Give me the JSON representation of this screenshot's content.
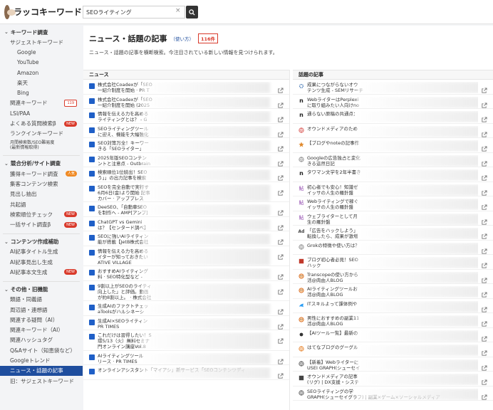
{
  "app": {
    "logo_text": "ラッコキーワード"
  },
  "search": {
    "value": "SEOライティング",
    "clear_glyph": "×"
  },
  "sidebar": {
    "keyword_section": {
      "title": "キーワード調査",
      "items": [
        {
          "label": "サジェストキーワード",
          "level": 1
        },
        {
          "label": "Google",
          "level": 2
        },
        {
          "label": "YouTube",
          "level": 2
        },
        {
          "label": "Amazon",
          "level": 2
        },
        {
          "label": "楽天",
          "level": 2
        },
        {
          "label": "Bing",
          "level": 2
        },
        {
          "label": "関連キーワード",
          "level": 1,
          "badge": "119",
          "badge_type": "count"
        },
        {
          "label": "LSI/PAA",
          "level": 1
        },
        {
          "label": "よくある質問検索β",
          "level": 1,
          "badge": "NEW",
          "badge_type": "new"
        },
        {
          "label": "ランクインキーワード",
          "level": 1
        },
        {
          "label": "月間検索数/SEO難易度\n(最新情報取得)",
          "level": 1,
          "small": true
        }
      ]
    },
    "competitor_section": {
      "title": "競合分析/サイト調査",
      "items": [
        {
          "label": "獲得キーワード調査",
          "badge": "人気",
          "badge_type": "popular"
        },
        {
          "label": "集客コンテンツ検索"
        },
        {
          "label": "見出し抽出"
        },
        {
          "label": "共起語"
        },
        {
          "label": "検索順位チェック",
          "badge": "NEW",
          "badge_type": "new"
        },
        {
          "label": "一括サイト調査β",
          "badge": "NEW",
          "badge_type": "new"
        }
      ]
    },
    "content_section": {
      "title": "コンテンツ作成補助",
      "items": [
        {
          "label": "AI記事タイトル生成"
        },
        {
          "label": "AI記事見出し生成"
        },
        {
          "label": "AI記事本文生成",
          "badge": "NEW",
          "badge_type": "new"
        }
      ]
    },
    "other_section": {
      "title": "その他・旧機能",
      "items": [
        {
          "label": "類語・同義語"
        },
        {
          "label": "周辺語・連想語"
        },
        {
          "label": "関連する疑問（AI）"
        },
        {
          "label": "関連キーワード（AI）"
        },
        {
          "label": "関連ハッシュタグ"
        },
        {
          "label": "Q&Aサイト（知恵袋など）"
        },
        {
          "label": "Googleトレンド"
        },
        {
          "label": "ニュース・話題の記事",
          "active": true
        },
        {
          "label": "旧：サジェストキーワード"
        }
      ]
    }
  },
  "main": {
    "title": "ニュース・話題の記事",
    "howto": "（使い方）",
    "count": "116",
    "count_unit": "件",
    "description": "ニュース・話題の記事を横断検索。今注目されている新しい情報を見つけられます。"
  },
  "news": {
    "header": "ニュース",
    "rows": [
      {
        "l1": "株式会社Coadexが「SEO",
        "l2": "一紹介制度を開始 · PR T",
        "icon_color": "#1f5fc7"
      },
      {
        "l1": "株式会社Coadexが「SEO",
        "l2": "一紹介制度を開始 (2025",
        "icon_color": "#1f5fc7"
      },
      {
        "l1": "情報を伝える力を高める",
        "l2": "ライティングとは？ - G",
        "icon_color": "#1f5fc7"
      },
      {
        "l1": "SEOライティングツール",
        "l2": "に迎え、機能を大幅強化",
        "icon_color": "#1f5fc7"
      },
      {
        "l1": "SEO対策万全！キーワー",
        "l2": "きる「SEOライター」",
        "icon_color": "#1f5fc7"
      },
      {
        "l1": "2025年版SEOコンテン",
        "l2": "ントと注意点 - Outbrain",
        "icon_color": "#1f5fc7"
      },
      {
        "l1": "検索順位1位続出！SEO",
        "l2": "う」」の出力記事を検索",
        "icon_color": "#1f5fc7"
      },
      {
        "l1": "SEOを完全自動で実行す",
        "l2": "6月6日(金)より開始 記事",
        "l3": "カバー · アッププレス",
        "icon_color": "#1f5fc7"
      },
      {
        "l1": "DeeSEO、「自動車SEO",
        "l2": "を制作へ - AMP[アンプ]",
        "icon_color": "#1f5fc7"
      },
      {
        "l1": "ChatGPT vs Gemini",
        "l2": "は？【センタード調べ】",
        "icon_color": "#1f5fc7"
      },
      {
        "l1": "SEOに強いAIライティン",
        "l2": "能が搭載【JetB株式会社",
        "icon_color": "#1f5fc7"
      },
      {
        "l1": "情報を伝える力を高める",
        "l2": "イターが知っておきたい",
        "l3": "ATIVE VILLAGE",
        "icon_color": "#1f5fc7"
      },
      {
        "l1": "おすすめAIライティング",
        "l2": "料 · SEO特化型など -",
        "icon_color": "#1f5fc7"
      },
      {
        "l1": "9割以上がSEOのライティ",
        "l2": "向上した」と評価。動画",
        "l3": "が約8割以上。 · 株式会社",
        "icon_color": "#1f5fc7"
      },
      {
        "l1": "生成AIのファクトチェッ",
        "l2": "aToolsがハルシネーシ",
        "icon_color": "#1f5fc7"
      },
      {
        "l1": "生成AI×SEOライティン",
        "l2": "PR TIMES",
        "icon_color": "#1f5fc7"
      },
      {
        "l1": "これだけは習得したい！S",
        "l2": "環5/13（火）無料セミナ",
        "l3": "門オンライン講座Vol.8",
        "icon_color": "#1f5fc7"
      },
      {
        "l1": "AIライティングツール",
        "l2": "リース · PR TIMES",
        "icon_color": "#1f5fc7"
      },
      {
        "l1": "オンラインアシスタント「マイアシ」新サービス「SEOコンテンツディ",
        "l2": "",
        "icon_color": "#1f5fc7"
      }
    ]
  },
  "topics": {
    "header": "話題の記事",
    "rows": [
      {
        "l1": "成果につながらないオウ",
        "l2": "テンツ生成 - SEMリサーチ",
        "icon": "gear",
        "icon_color": "#3a6fb0"
      },
      {
        "l1": "WebライターはPerplexi",
        "l2": "に取り組みたい人向けno",
        "icon": "n",
        "icon_color": "#222"
      },
      {
        "l1": "通らない原稿の共通点：",
        "l2": "",
        "icon": "n",
        "icon_color": "#222"
      },
      {
        "l1": "オウンドメディアのため",
        "l2": "",
        "icon": "globe",
        "icon_color": "#d9534f"
      },
      {
        "l1": "【ブログやnoteの記事作",
        "l2": "",
        "icon": "star",
        "icon_color": "#e08a2e"
      },
      {
        "l1": "Googleの広告独占と変化",
        "l2": "きる這然日記",
        "icon": "globe",
        "icon_color": "#888"
      },
      {
        "l1": "タワマン文学を2年半書き",
        "l2": "",
        "icon": "n",
        "icon_color": "#222"
      },
      {
        "l1": "初心者でも安心！知識ゼ",
        "l2": "イッサの人生の羅針盤",
        "icon": "kanji",
        "icon_color": "#9b59b6"
      },
      {
        "l1": "Webライティングで稼ぐ",
        "l2": "イッサの人生の羅針盤",
        "icon": "kanji",
        "icon_color": "#9b59b6"
      },
      {
        "l1": "ウェブライターとして月",
        "l2": "生の羅針盤",
        "icon": "kanji",
        "icon_color": "#9b59b6"
      },
      {
        "l1": "「広告をハックしよう」",
        "l2": "転換したら、成果が激増",
        "icon": "ad",
        "icon_color": "#444"
      },
      {
        "l1": "Grokの特徴や使い方は？",
        "l2": "",
        "icon": "globe",
        "icon_color": "#888"
      },
      {
        "l1": "ブログ初心者必見！SEO",
        "l2": "ハック",
        "icon": "square",
        "icon_color": "#c0392b"
      },
      {
        "l1": "Transcopeの使い方から",
        "l2": "活@肉由人BLOG",
        "icon": "face",
        "icon_color": "#d35400"
      },
      {
        "l1": "AIライティングツールお",
        "l2": "活@肉由人BLOG",
        "icon": "face",
        "icon_color": "#d35400"
      },
      {
        "l1": "ITスキルよって課体例や",
        "l2": "",
        "icon": "bird",
        "icon_color": "#2a9df4"
      },
      {
        "l1": "男性におすすめの副業11",
        "l2": "活@肉由人BLOG",
        "icon": "face",
        "icon_color": "#d35400"
      },
      {
        "l1": "【AIツール一覧】最新の",
        "l2": "",
        "icon": "dot",
        "icon_color": "#333"
      },
      {
        "l1": "はてなブログのグーグル",
        "l2": "",
        "icon": "globe",
        "icon_color": "#e67e22"
      },
      {
        "l1": "【新着】Webライターに",
        "l2": "USEI GRAPH(シューセイ",
        "icon": "globe",
        "icon_color": "#555"
      },
      {
        "l1": "オウンドメディアの記事",
        "l2": "(リグ) | DX支援・システ",
        "icon": "square",
        "icon_color": "#444"
      },
      {
        "l1": "SEOライティングの学",
        "l2": "GRAPH(シューセイグラフ) | 副業×ゲーム×ソーシャルメディア",
        "icon": "globe",
        "icon_color": "#555"
      }
    ]
  }
}
